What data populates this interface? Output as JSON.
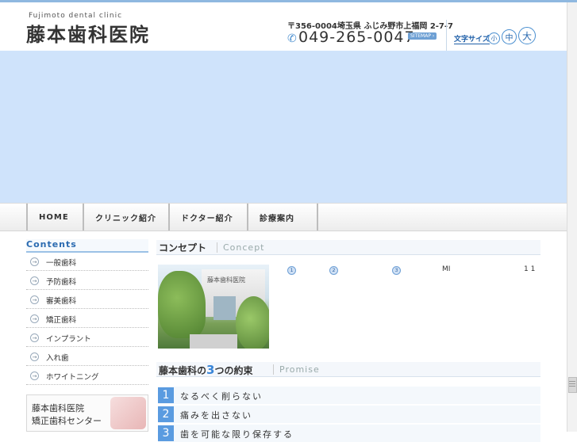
{
  "header": {
    "logo_en": "Fujimoto dental clinic",
    "logo_jp": "藤本歯科医院",
    "address": "〒356-0004埼玉県 ふじみ野市上福岡 2-7-7",
    "phone": "049-265-0047",
    "sitemap_label": "SITEMAP",
    "font_size_label": "文字サイズ",
    "font_sizes": [
      "小",
      "中",
      "大"
    ]
  },
  "nav": {
    "items": [
      "HOME",
      "クリニック紹介",
      "ドクター紹介",
      "診療案内"
    ]
  },
  "sidebar": {
    "title": "Contents",
    "items": [
      "一般歯科",
      "予防歯科",
      "審美歯科",
      "矯正歯科",
      "インプラント",
      "入れ歯",
      "ホワイトニング"
    ],
    "banner_line1": "藤本歯科医院",
    "banner_line2": "矯正歯科センター"
  },
  "concept": {
    "title_jp": "コンセプト",
    "title_en": "Concept",
    "photo_sign": "藤本歯科医院",
    "markers": [
      "1",
      "2",
      "3"
    ],
    "text_mi": "MI",
    "text_11": "1 1"
  },
  "promise": {
    "title_pre": "藤本歯科の",
    "title_num": "3",
    "title_post": "つの約束",
    "title_en": "Promise",
    "items": [
      {
        "num": "1",
        "text": "なるべく削らない"
      },
      {
        "num": "2",
        "text": "痛みを出さない"
      },
      {
        "num": "3",
        "text": "歯を可能な限り保存する"
      }
    ]
  },
  "colors": {
    "accent": "#2a6ab0",
    "hero_bg": "#cfe3fb",
    "promise_num": "#5a9be0"
  }
}
